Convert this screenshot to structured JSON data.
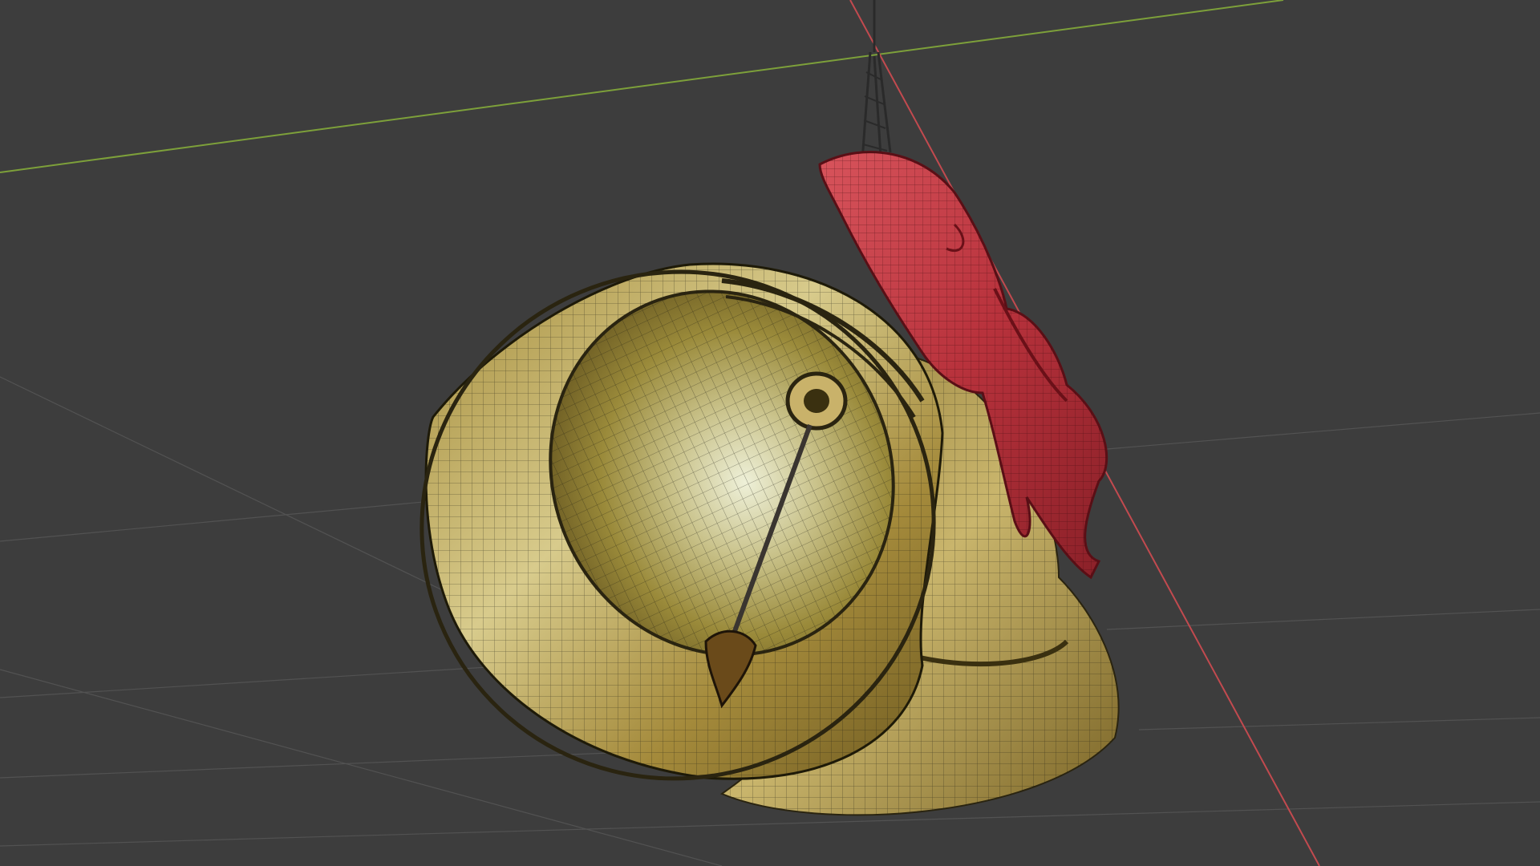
{
  "viewport": {
    "background": "#3d3d3d",
    "grid_color": "#555555",
    "x_axis_color": "#c24a4f",
    "y_axis_color": "#7da03a"
  },
  "scene": {
    "objects": [
      {
        "name": "hanging-chain",
        "material": "dark-metal",
        "color": "#2a2a2a"
      },
      {
        "name": "red-ribbon-bow",
        "material": "cloth",
        "color": "#c23a44"
      },
      {
        "name": "front-bell",
        "material": "brass",
        "color": "#b79a4a"
      },
      {
        "name": "back-bell",
        "material": "brass",
        "color": "#b79a4a"
      },
      {
        "name": "bell-clapper",
        "material": "dark-metal",
        "color": "#4a3a1a"
      }
    ],
    "overlay": "wireframe"
  }
}
